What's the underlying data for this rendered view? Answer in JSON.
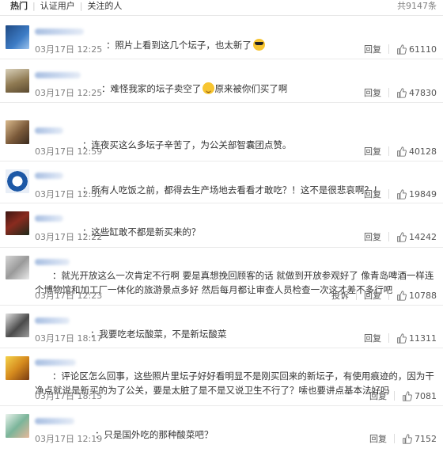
{
  "tabs": {
    "hot": "热门",
    "verified": "认证用户",
    "following": "关注的人",
    "total": "共9147条"
  },
  "labels": {
    "reply": "回复",
    "report": "投诉"
  },
  "comments": [
    {
      "text": "：照片上看到这几个坛子，也太新了",
      "emoji": "sunglasses-emoji",
      "time": "03月17日 12:25",
      "likes": "61110",
      "avatar_color": "#2c5d9a"
    },
    {
      "text": "：难怪我家的坛子卖空了",
      "emoji": "laughing-emoji",
      "text2": "原来被你们买了啊",
      "time": "03月17日 12:25",
      "likes": "47830",
      "avatar_color": "#8f7a52"
    },
    {
      "text": "：连夜买这么多坛子辛苦了，为公关部智囊团点赞。",
      "time": "03月17日 12:59",
      "likes": "40128",
      "avatar_color": "#7b5a3a"
    },
    {
      "text": "：所有人吃饭之前，都得去生产场地去看看才敢吃？！这不是很悲哀啊？！",
      "time": "03月17日 12:32",
      "likes": "19849",
      "avatar_color": "#1d58a6"
    },
    {
      "text": "：这些缸敢不都是新买来的？",
      "time": "03月17日 12:22",
      "likes": "14242",
      "avatar_color": "#5e1f19"
    },
    {
      "text": "：就光开放这么一次肯定不行啊 要是真想挽回顾客的话 就做到开放参观好了 像青岛啤酒一样连个博物馆和加工厂一体化的旅游景点多好 然后每月都让审查人员检查一次这才差不多行吧",
      "time": "03月17日 12:23",
      "likes": "10788",
      "avatar_color": "#9a9a9a"
    },
    {
      "text": "：我要吃老坛酸菜，不是新坛酸菜",
      "time": "03月17日 18:17",
      "likes": "11311",
      "avatar_color": "#4b4b4b"
    },
    {
      "text": "：评论区怎么回事，这些照片里坛子好好看明显不是刚买回来的新坛子，有使用痕迹的，因为干净点就说是新买的为了公关，要是太脏了是不是又说卫生不行了？嗦也要讲点基本法好吗",
      "time": "03月17日 18:15",
      "likes": "7081",
      "avatar_color": "#d58a1e"
    },
    {
      "text": "：只是国外吃的那种酸菜吧？",
      "time": "03月17日 12:19",
      "likes": "7152",
      "avatar_color": "#7bb59a"
    }
  ]
}
